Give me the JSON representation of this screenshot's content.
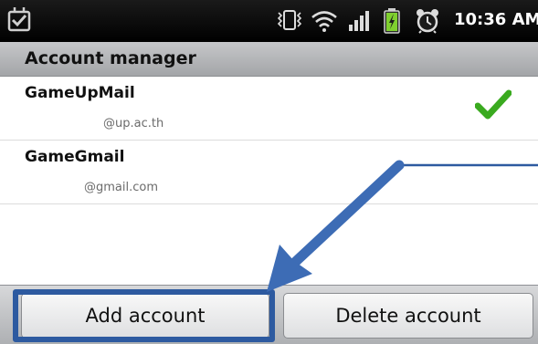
{
  "status_bar": {
    "time": "10:36 AM",
    "icons": [
      "notification-check-icon",
      "vibrate-icon",
      "wifi-icon",
      "signal-icon",
      "battery-charging-icon",
      "alarm-icon"
    ]
  },
  "header": {
    "title": "Account manager"
  },
  "accounts": [
    {
      "name": "GameUpMail",
      "email": "@up.ac.th",
      "selected": true
    },
    {
      "name": "GameGmail",
      "email": "@gmail.com",
      "selected": false
    }
  ],
  "actions": {
    "add_label": "Add account",
    "delete_label": "Delete account"
  },
  "colors": {
    "annotation_blue": "#2d5aa0",
    "check_green": "#3aaa1f"
  }
}
